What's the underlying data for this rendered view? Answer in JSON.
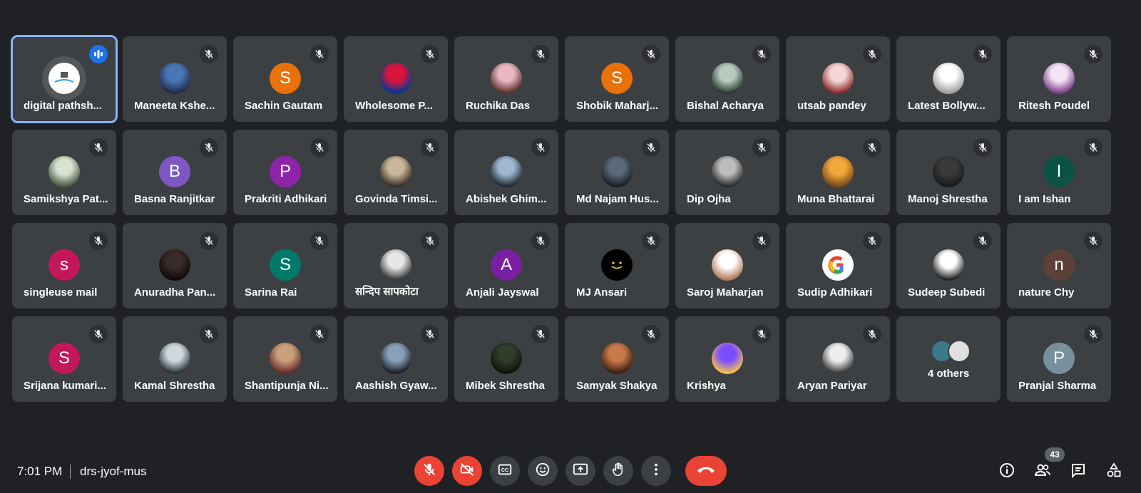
{
  "meeting": {
    "time": "7:01 PM",
    "code": "drs-jyof-mus",
    "participant_count": "43"
  },
  "tiles": [
    {
      "name": "digital pathsh...",
      "avatar": {
        "type": "logo"
      },
      "mic": "speaking",
      "active": true
    },
    {
      "name": "Maneeta Kshe...",
      "avatar": {
        "type": "photo",
        "colors": [
          "#4a76b8",
          "#1e2d4a"
        ]
      },
      "mic": "muted"
    },
    {
      "name": "Sachin Gautam",
      "avatar": {
        "type": "letter",
        "letter": "S",
        "color": "#e8710a"
      },
      "mic": "muted"
    },
    {
      "name": "Wholesome P...",
      "avatar": {
        "type": "photo",
        "colors": [
          "#dc143c",
          "#003893"
        ]
      },
      "mic": "muted"
    },
    {
      "name": "Ruchika Das",
      "avatar": {
        "type": "photo",
        "colors": [
          "#e7b7c2",
          "#5a2e2a"
        ]
      },
      "mic": "muted"
    },
    {
      "name": "Shobik Maharj...",
      "avatar": {
        "type": "letter",
        "letter": "S",
        "color": "#e8710a"
      },
      "mic": "muted"
    },
    {
      "name": "Bishal Acharya",
      "avatar": {
        "type": "photo",
        "colors": [
          "#b9c9c0",
          "#2b3a30"
        ]
      },
      "mic": "muted"
    },
    {
      "name": "utsab pandey",
      "avatar": {
        "type": "photo",
        "colors": [
          "#f3d6d6",
          "#8a2a2a"
        ]
      },
      "mic": "muted"
    },
    {
      "name": "Latest Bollyw...",
      "avatar": {
        "type": "photo",
        "colors": [
          "#ffffff",
          "#9e9e9e"
        ]
      },
      "mic": "muted"
    },
    {
      "name": "Ritesh Poudel",
      "avatar": {
        "type": "photo",
        "colors": [
          "#f4e3f2",
          "#7a3f8a"
        ]
      },
      "mic": "muted"
    },
    {
      "name": "Samikshya Pat...",
      "avatar": {
        "type": "photo",
        "colors": [
          "#d7e2d0",
          "#4b5a45"
        ]
      },
      "mic": "muted"
    },
    {
      "name": "Basna Ranjitkar",
      "avatar": {
        "type": "letter",
        "letter": "B",
        "color": "#7e57c2"
      },
      "mic": "muted"
    },
    {
      "name": "Prakriti Adhikari",
      "avatar": {
        "type": "letter",
        "letter": "P",
        "color": "#8e24aa"
      },
      "mic": "muted"
    },
    {
      "name": "Govinda Timsi...",
      "avatar": {
        "type": "photo",
        "colors": [
          "#c9b79b",
          "#3a3026"
        ]
      },
      "mic": "muted"
    },
    {
      "name": "Abishek Ghim...",
      "avatar": {
        "type": "photo",
        "colors": [
          "#9fb7cf",
          "#1f2a35"
        ]
      },
      "mic": "muted"
    },
    {
      "name": "Md Najam Hus...",
      "avatar": {
        "type": "photo",
        "colors": [
          "#5a6a7a",
          "#1a1e24"
        ]
      },
      "mic": "muted"
    },
    {
      "name": "Dip Ojha",
      "avatar": {
        "type": "photo",
        "colors": [
          "#bdbdbd",
          "#2a2a2a"
        ]
      },
      "mic": "muted"
    },
    {
      "name": "Muna Bhattarai",
      "avatar": {
        "type": "photo",
        "colors": [
          "#f2a93b",
          "#7a4a1a"
        ]
      },
      "mic": "muted"
    },
    {
      "name": "Manoj Shrestha",
      "avatar": {
        "type": "photo",
        "colors": [
          "#3a3a3a",
          "#1a1a1a"
        ]
      },
      "mic": "muted"
    },
    {
      "name": "I am Ishan",
      "avatar": {
        "type": "letter",
        "letter": "I",
        "color": "#0b5345"
      },
      "mic": "muted"
    },
    {
      "name": "singleuse mail",
      "avatar": {
        "type": "letter",
        "letter": "s",
        "color": "#c2185b"
      },
      "mic": "muted"
    },
    {
      "name": "Anuradha Pan...",
      "avatar": {
        "type": "photo",
        "colors": [
          "#3a2a2a",
          "#0f0a0a"
        ]
      },
      "mic": "muted"
    },
    {
      "name": "Sarina Rai",
      "avatar": {
        "type": "letter",
        "letter": "S",
        "color": "#00796b"
      },
      "mic": "muted"
    },
    {
      "name": "सन्दिप सापकोटा",
      "avatar": {
        "type": "photo",
        "colors": [
          "#e6e6e6",
          "#3a3a3a"
        ]
      },
      "mic": "muted"
    },
    {
      "name": "Anjali Jayswal",
      "avatar": {
        "type": "letter",
        "letter": "A",
        "color": "#7b1fa2"
      },
      "mic": "muted"
    },
    {
      "name": "MJ Ansari",
      "avatar": {
        "type": "smiley"
      },
      "mic": "muted"
    },
    {
      "name": "Saroj Maharjan",
      "avatar": {
        "type": "photo",
        "colors": [
          "#ffffff",
          "#b07a5a"
        ]
      },
      "mic": "muted"
    },
    {
      "name": "Sudip Adhikari",
      "avatar": {
        "type": "glogo"
      },
      "mic": "muted"
    },
    {
      "name": "Sudeep Subedi",
      "avatar": {
        "type": "photo",
        "colors": [
          "#ffffff",
          "#222222"
        ]
      },
      "mic": "muted"
    },
    {
      "name": "nature Chy",
      "avatar": {
        "type": "letter",
        "letter": "n",
        "color": "#5d4037"
      },
      "mic": "muted"
    },
    {
      "name": "Srijana kumari...",
      "avatar": {
        "type": "letter",
        "letter": "S",
        "color": "#c2185b"
      },
      "mic": "muted"
    },
    {
      "name": "Kamal Shrestha",
      "avatar": {
        "type": "photo",
        "colors": [
          "#cfd8dc",
          "#263238"
        ]
      },
      "mic": "muted"
    },
    {
      "name": "Shantipunja Ni...",
      "avatar": {
        "type": "photo",
        "colors": [
          "#c7a27a",
          "#6a2b2b"
        ]
      },
      "mic": "muted"
    },
    {
      "name": "Aashish Gyaw...",
      "avatar": {
        "type": "photo",
        "colors": [
          "#8aa0b8",
          "#1a1f26"
        ]
      },
      "mic": "muted"
    },
    {
      "name": "Mibek Shrestha",
      "avatar": {
        "type": "photo",
        "colors": [
          "#2f3d2a",
          "#0d120b"
        ]
      },
      "mic": "muted"
    },
    {
      "name": "Samyak Shakya",
      "avatar": {
        "type": "photo",
        "colors": [
          "#c8794a",
          "#3a1f12"
        ]
      },
      "mic": "muted"
    },
    {
      "name": "Krishya",
      "avatar": {
        "type": "photo",
        "colors": [
          "#7c4dff",
          "#f2c14e"
        ]
      },
      "mic": "muted"
    },
    {
      "name": "Aryan Pariyar",
      "avatar": {
        "type": "photo",
        "colors": [
          "#eeeeee",
          "#3a3a3a"
        ]
      },
      "mic": "muted"
    },
    {
      "others": true,
      "label": "4 others",
      "stack_colors": [
        "#3a7a8a",
        "#e0e0e0"
      ]
    },
    {
      "name": "Pranjal Sharma",
      "avatar": {
        "type": "letter",
        "letter": "P",
        "color": "#78909c"
      },
      "mic": "muted"
    }
  ],
  "controls": [
    {
      "name": "mic-toggle-button",
      "icon": "mic-off-icon",
      "red": true
    },
    {
      "name": "camera-toggle-button",
      "icon": "camera-off-icon",
      "red": true
    },
    {
      "name": "captions-button",
      "icon": "captions-icon"
    },
    {
      "name": "reactions-button",
      "icon": "emoji-icon"
    },
    {
      "name": "present-button",
      "icon": "present-screen-icon"
    },
    {
      "name": "raise-hand-button",
      "icon": "hand-icon"
    },
    {
      "name": "more-options-button",
      "icon": "more-vert-icon"
    }
  ],
  "end_call": {
    "icon": "phone-hangup-icon"
  },
  "right_icons": [
    {
      "name": "meeting-details-button",
      "icon": "info-icon"
    },
    {
      "name": "people-button",
      "icon": "people-icon"
    },
    {
      "name": "chat-button",
      "icon": "chat-icon"
    },
    {
      "name": "activities-button",
      "icon": "activities-icon"
    }
  ]
}
